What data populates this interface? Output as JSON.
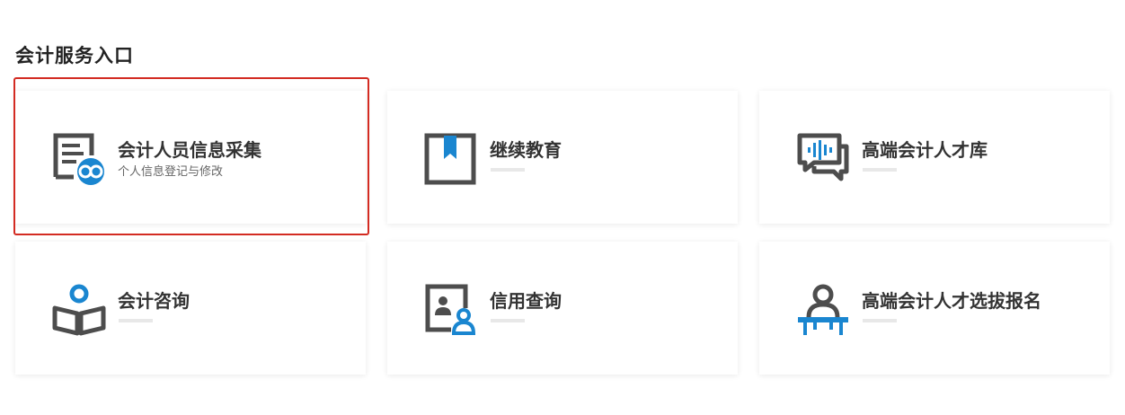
{
  "section": {
    "title": "会计服务入口"
  },
  "colors": {
    "icon_gray": "#4d4d4d",
    "icon_blue": "#1a86d0",
    "highlight_border": "#d32b22"
  },
  "cards": [
    {
      "title": "会计人员信息采集",
      "subtitle": "个人信息登记与修改",
      "icon": "form-link-icon"
    },
    {
      "title": "继续教育",
      "subtitle": "",
      "icon": "bookmark-icon"
    },
    {
      "title": "高端会计人才库",
      "subtitle": "",
      "icon": "voice-chat-icon"
    },
    {
      "title": "会计咨询",
      "subtitle": "",
      "icon": "reading-person-icon"
    },
    {
      "title": "信用查询",
      "subtitle": "",
      "icon": "id-card-user-icon"
    },
    {
      "title": "高端会计人才选拔报名",
      "subtitle": "",
      "icon": "podium-person-icon"
    }
  ]
}
